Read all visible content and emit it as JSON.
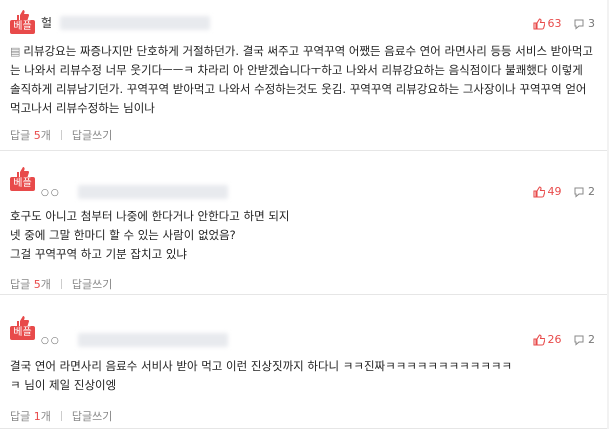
{
  "best_label": "베플",
  "reply_label": "답글",
  "reply_count_unit": "개",
  "write_reply_label": "답글쓰기",
  "like_icon": "thumbs-up-icon",
  "reply_icon": "speech-bubble-icon",
  "accent_color": "#e84a4a",
  "comments": [
    {
      "nickname": "헐",
      "likes": "63",
      "replies": "3",
      "doc_icon": "document-icon",
      "text": "리뷰강요는 짜증나지만 단호하게 거절하던가. 결국 써주고 꾸역꾸역 어쨌든 음료수 연어 라면사리 등등 서비스 받아먹고는 나와서 리뷰수정 너무 웃기다ㅡㅡㅋ 차라리 아 안받겠습니다ㅜ하고 나와서 리뷰강요하는 음식점이다 불쾌했다 이렇게 솔직하게 리뷰남기던가. 꾸역꾸역 받아먹고 나와서 수정하는것도 웃김. 꾸역꾸역 리뷰강요하는 그사장이나 꾸역꾸역 얻어먹고나서 리뷰수정하는 님이나",
      "reply_num": "5"
    },
    {
      "nickname_icons": "○○",
      "likes": "49",
      "replies": "2",
      "text_lines": [
        "호구도 아니고 첨부터 나중에 한다거나 안한다고 하면 되지",
        "넷 중에 그말 한마디 할 수 있는 사람이 없었음?",
        "그걸 꾸역꾸역 하고 기분 잡치고 있냐"
      ],
      "reply_num": "5"
    },
    {
      "nickname_icons": "○○",
      "likes": "26",
      "replies": "2",
      "text_lines": [
        "결국 연어 라면사리 음료수 서비사 받아 먹고 이런 진상짓까지 하다니 ㅋㅋ진짜ㅋㅋㅋㅋㅋㅋㅋㅋㅋㅋㅋㅋ",
        "ㅋ 님이 제일 진상이엥"
      ],
      "reply_num": "1"
    }
  ]
}
